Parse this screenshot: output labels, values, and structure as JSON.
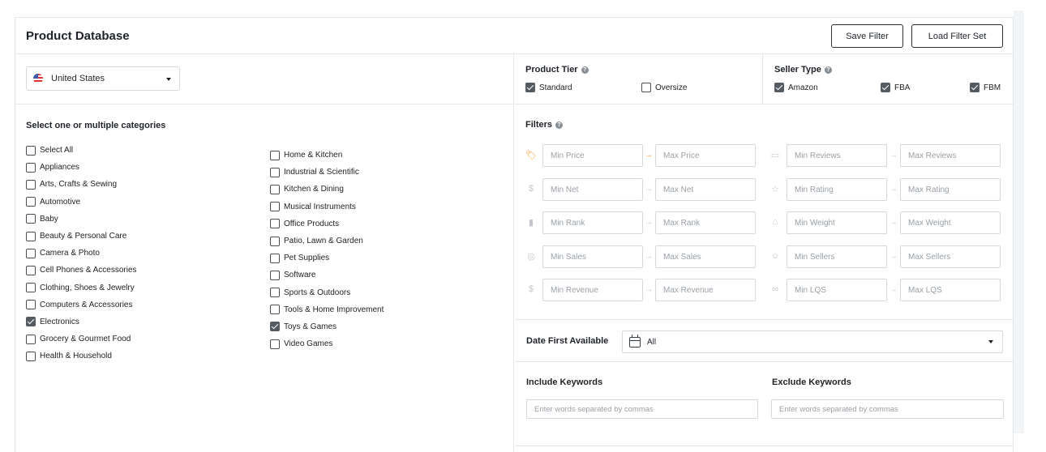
{
  "header": {
    "title": "Product Database",
    "save_filter": "Save Filter",
    "load_filter_set": "Load Filter Set"
  },
  "country": {
    "selected": "United States",
    "flag_icon": "us-flag-icon"
  },
  "categories": {
    "heading": "Select one or multiple categories",
    "column1": [
      {
        "label": "Select All",
        "checked": false
      },
      {
        "label": "Appliances",
        "checked": false
      },
      {
        "label": "Arts, Crafts & Sewing",
        "checked": false
      },
      {
        "label": "Automotive",
        "checked": false
      },
      {
        "label": "Baby",
        "checked": false
      },
      {
        "label": "Beauty & Personal Care",
        "checked": false
      },
      {
        "label": "Camera & Photo",
        "checked": false
      },
      {
        "label": "Cell Phones & Accessories",
        "checked": false
      },
      {
        "label": "Clothing, Shoes & Jewelry",
        "checked": false
      },
      {
        "label": "Computers & Accessories",
        "checked": false
      },
      {
        "label": "Electronics",
        "checked": true
      },
      {
        "label": "Grocery & Gourmet Food",
        "checked": false
      },
      {
        "label": "Health & Household",
        "checked": false
      }
    ],
    "column2": [
      {
        "label": "Home & Kitchen",
        "checked": false
      },
      {
        "label": "Industrial & Scientific",
        "checked": false
      },
      {
        "label": "Kitchen & Dining",
        "checked": false
      },
      {
        "label": "Musical Instruments",
        "checked": false
      },
      {
        "label": "Office Products",
        "checked": false
      },
      {
        "label": "Patio, Lawn & Garden",
        "checked": false
      },
      {
        "label": "Pet Supplies",
        "checked": false
      },
      {
        "label": "Software",
        "checked": false
      },
      {
        "label": "Sports & Outdoors",
        "checked": false
      },
      {
        "label": "Tools & Home Improvement",
        "checked": false
      },
      {
        "label": "Toys & Games",
        "checked": true
      },
      {
        "label": "Video Games",
        "checked": false
      }
    ]
  },
  "product_tier": {
    "label": "Product Tier",
    "standard": {
      "label": "Standard",
      "checked": true
    },
    "oversize": {
      "label": "Oversize",
      "checked": false
    }
  },
  "seller_type": {
    "label": "Seller Type",
    "amazon": {
      "label": "Amazon",
      "checked": true
    },
    "fba": {
      "label": "FBA",
      "checked": true
    },
    "fbm": {
      "label": "FBM",
      "checked": true
    }
  },
  "filters": {
    "label": "Filters",
    "left": [
      {
        "icon": "price-tag-icon",
        "glyph": "🏷",
        "min": "Min Price",
        "max": "Max Price",
        "active": true
      },
      {
        "icon": "money-bag-icon",
        "glyph": "$",
        "min": "Min Net",
        "max": "Max Net",
        "active": false
      },
      {
        "icon": "bar-chart-icon",
        "glyph": "▮",
        "min": "Min Rank",
        "max": "Max Rank",
        "active": false
      },
      {
        "icon": "sales-icon",
        "glyph": "◎",
        "min": "Min Sales",
        "max": "Max Sales",
        "active": false
      },
      {
        "icon": "revenue-icon",
        "glyph": "$",
        "min": "Min Revenue",
        "max": "Max Revenue",
        "active": false
      }
    ],
    "right": [
      {
        "icon": "reviews-icon",
        "glyph": "▭",
        "min": "Min Reviews",
        "max": "Max Reviews",
        "active": false
      },
      {
        "icon": "star-icon",
        "glyph": "☆",
        "min": "Min Rating",
        "max": "Max Rating",
        "active": false
      },
      {
        "icon": "weight-icon",
        "glyph": "⌂",
        "min": "Min Weight",
        "max": "Max Weight",
        "active": false
      },
      {
        "icon": "sellers-icon",
        "glyph": "☺",
        "min": "Min Sellers",
        "max": "Max Sellers",
        "active": false
      },
      {
        "icon": "lqs-icon",
        "glyph": "∞",
        "min": "Min LQS",
        "max": "Max LQS",
        "active": false
      }
    ]
  },
  "date_first_available": {
    "label": "Date First Available",
    "value": "All"
  },
  "keywords": {
    "include_label": "Include Keywords",
    "include_placeholder": "Enter words separated by commas",
    "exclude_label": "Exclude Keywords",
    "exclude_placeholder": "Enter words separated by commas"
  },
  "colors": {
    "accent": "#f39a2b",
    "checkbox": "#555b62",
    "border": "#e3e6ea"
  }
}
